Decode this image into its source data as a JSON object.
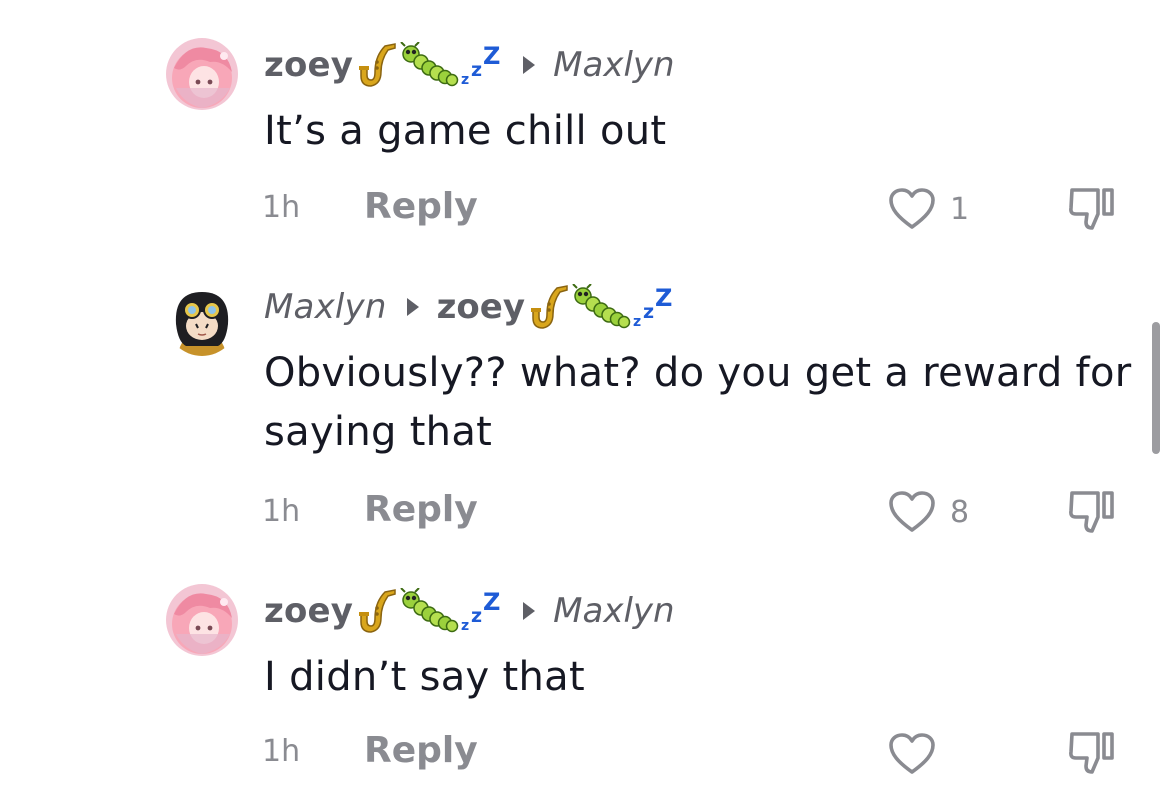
{
  "comments": [
    {
      "author": "zoey",
      "author_emojis": [
        "saxophone-emoji",
        "caterpillar-emoji",
        "zzz-emoji"
      ],
      "reply_to": "Maxlyn",
      "text": "It’s a game chill out",
      "time": "1h",
      "reply_label": "Reply",
      "likes": "1"
    },
    {
      "author": "Maxlyn",
      "reply_to": "zoey",
      "reply_to_emojis": [
        "saxophone-emoji",
        "caterpillar-emoji",
        "zzz-emoji"
      ],
      "text": "Obviously?? what? do you get a reward for saying that",
      "time": "1h",
      "reply_label": "Reply",
      "likes": "8"
    },
    {
      "author": "zoey",
      "author_emojis": [
        "saxophone-emoji",
        "caterpillar-emoji",
        "zzz-emoji"
      ],
      "reply_to": "Maxlyn",
      "text": "I didn’t say that",
      "time": "1h",
      "reply_label": "Reply",
      "likes": ""
    }
  ],
  "colors": {
    "text": "#161823",
    "secondary": "#5e5f66",
    "muted": "#8a8b91",
    "zzz_blue": "#1e5bd6"
  }
}
